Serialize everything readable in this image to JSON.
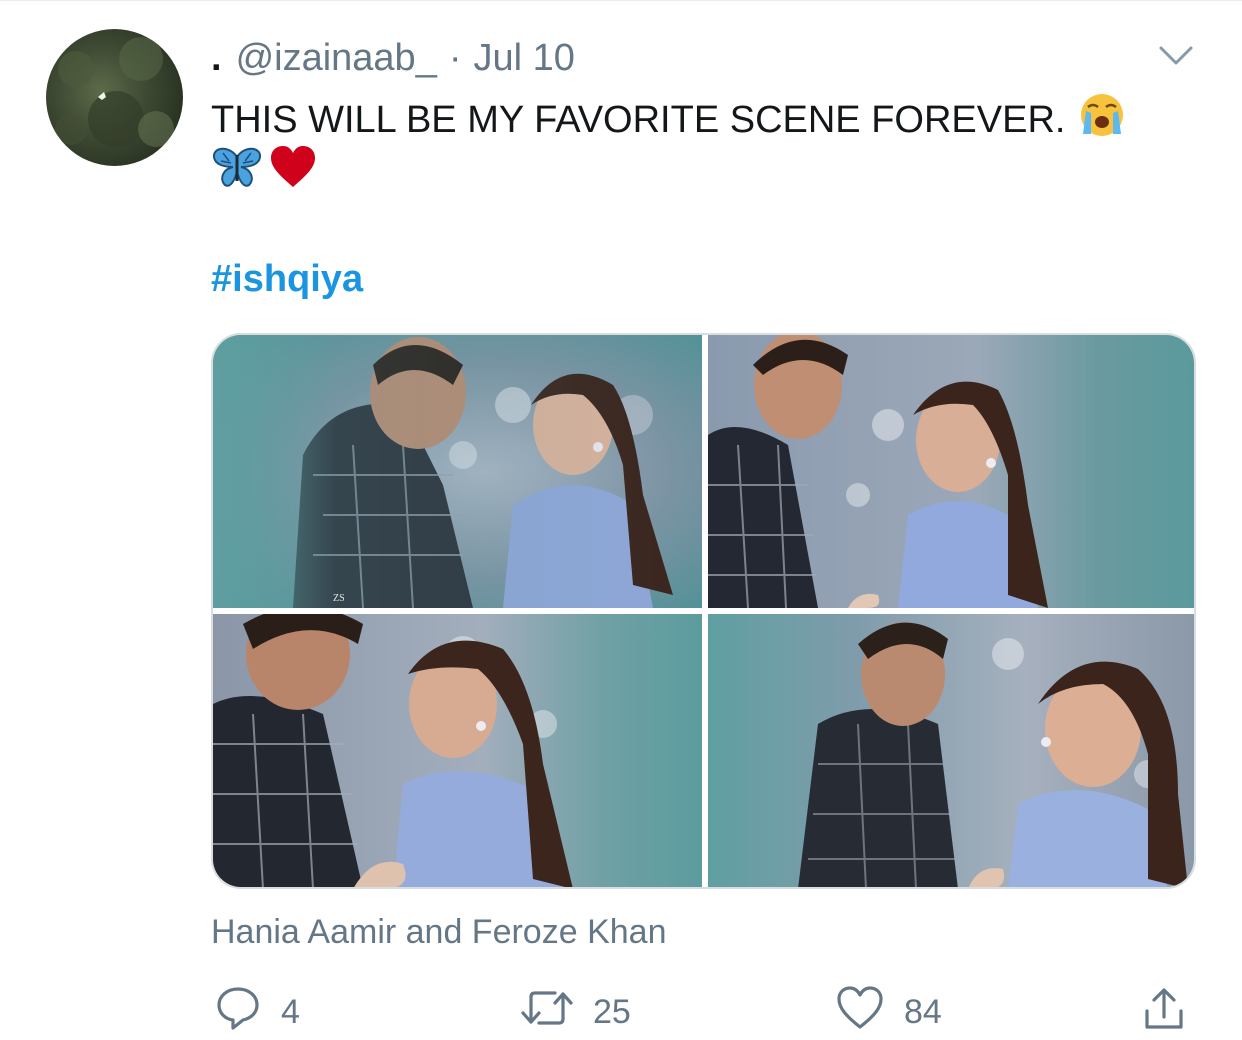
{
  "tweet": {
    "display_name": ".",
    "handle": "@izainaab_",
    "separator": "·",
    "date": "Jul 10",
    "text": "THIS WILL BE MY FAVORITE SCENE FOREVER.",
    "emoji_after_text": "loudly-crying-face",
    "emoji_line": [
      "butterfly",
      "red-heart"
    ],
    "hashtag": "#ishqiya",
    "tagged_people": "Hania Aamir and Feroze Khan",
    "photos": [
      {
        "subject": "couple facing each other, teal vignette, watermark ZS",
        "watermark": "ZS"
      },
      {
        "subject": "couple smiling, teal vignette"
      },
      {
        "subject": "couple close, teal vignette"
      },
      {
        "subject": "woman glancing sideways, teal vignette"
      }
    ]
  },
  "actions": {
    "reply_count": "4",
    "retweet_count": "25",
    "like_count": "84"
  },
  "colors": {
    "link": "#1b95e0",
    "secondary_text": "#657786",
    "primary_text": "#14171a",
    "photo_teal": "#5e9ea0"
  }
}
